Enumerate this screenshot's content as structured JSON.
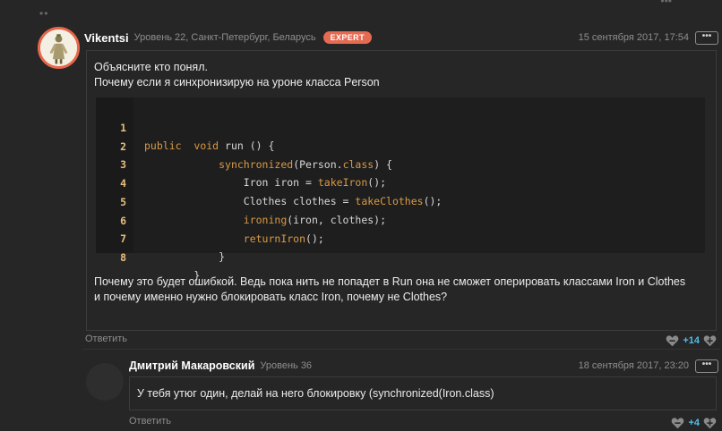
{
  "main_comment": {
    "username": "Vikentsi",
    "level_location": "Уровень 22, Санкт-Петербург, Беларусь",
    "badge": "EXPERT",
    "date": "15 сентября 2017, 17:54",
    "more": "•••",
    "question_lines": [
      "Объясните кто понял.",
      "Почему если я синхронизирую на уроне класса Person"
    ],
    "code": {
      "line_numbers": [
        "1",
        "2",
        "3",
        "4",
        "5",
        "6",
        "7",
        "8"
      ]
    },
    "followup_lines": [
      "Почему это будет ошибкой. Ведь пока нить не попадет в Run она не сможет оперировать классами Iron и Clothes",
      "и почему именно нужно блокировать класс Iron, почему не Clothes?"
    ],
    "reply_label": "Ответить",
    "votes": "+14"
  },
  "reply_comment": {
    "username": "Дмитрий Макаровский",
    "level": "Уровень 36",
    "date": "18 сентября 2017, 23:20",
    "more": "•••",
    "text": "У тебя утюг один, делай на него блокировку (synchronized(Iron.class)",
    "reply_label": "Ответить",
    "votes": "+4"
  },
  "colors": {
    "background": "#262627",
    "accent_vote": "#53bde8",
    "badge": "#e56a52",
    "code_keyword": "#d99a44",
    "line_number": "#e8c07a"
  }
}
